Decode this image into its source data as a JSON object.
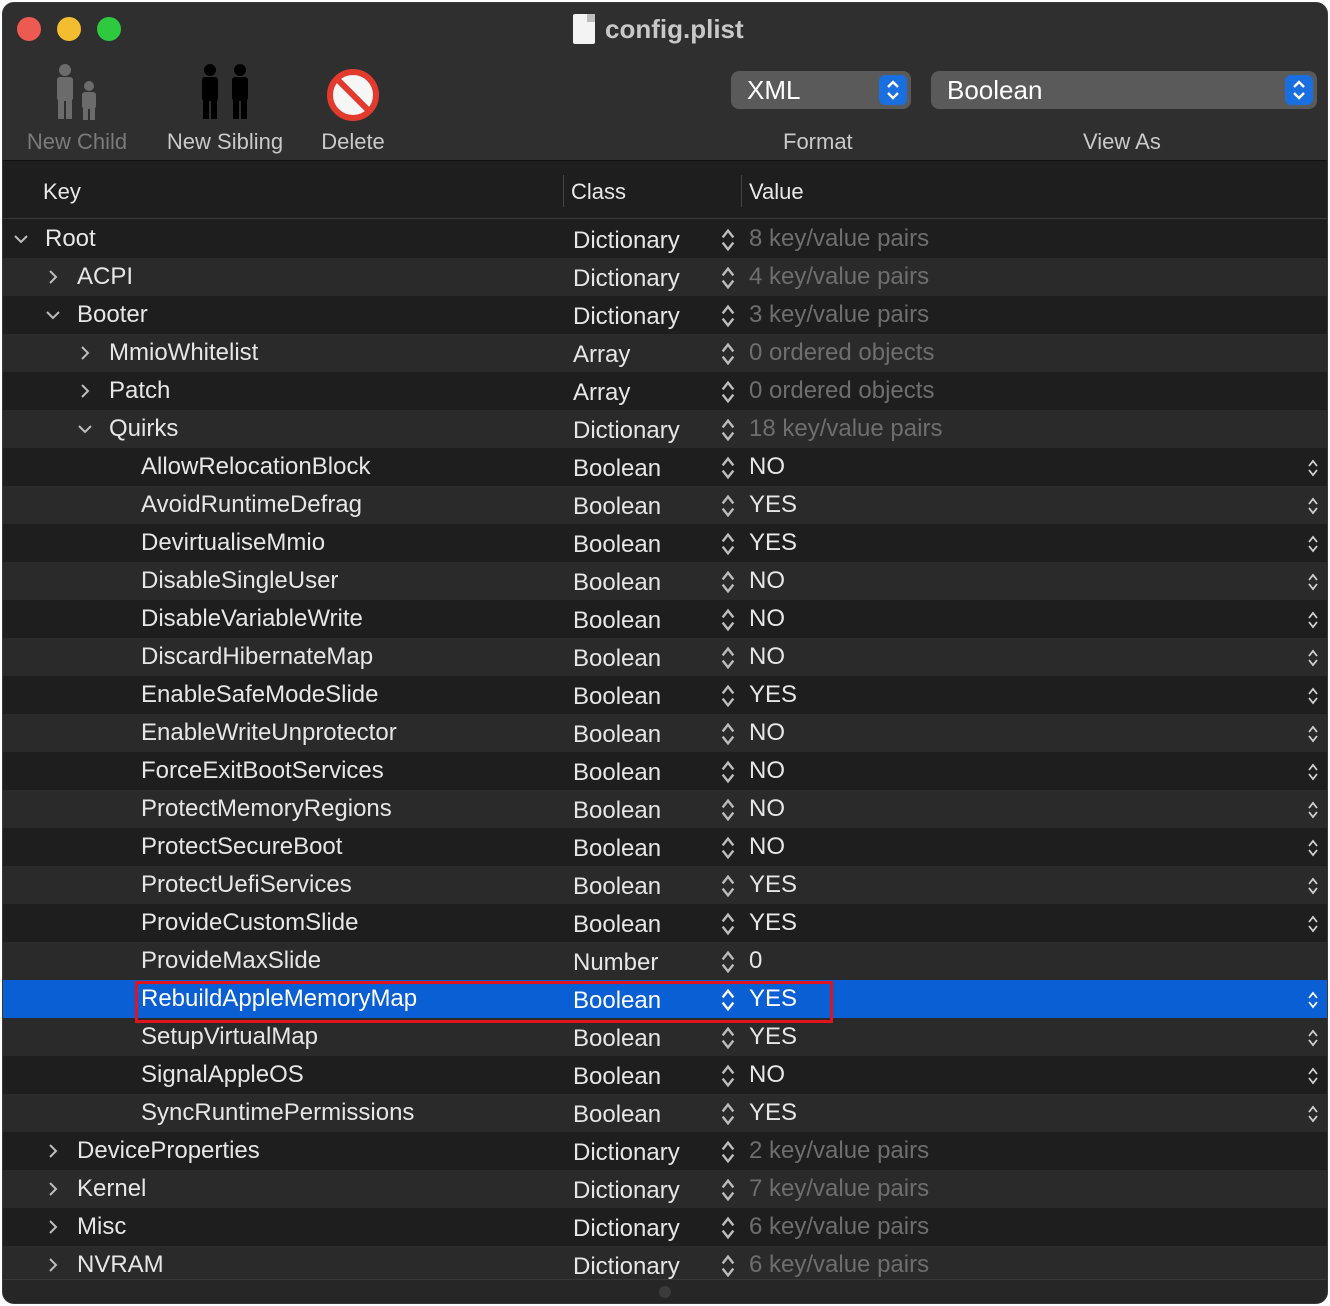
{
  "window": {
    "title": "config.plist"
  },
  "toolbar": {
    "new_child": "New Child",
    "new_sibling": "New Sibling",
    "delete": "Delete",
    "format_value": "XML",
    "view_as_value": "Boolean",
    "format_label": "Format",
    "view_as_label": "View As"
  },
  "columns": {
    "key": "Key",
    "class": "Class",
    "value": "Value"
  },
  "rows": [
    {
      "key": "Root",
      "depth": 0,
      "disclosure": "down",
      "class": "Dictionary",
      "value": "8 key/value pairs",
      "dim": true
    },
    {
      "key": "ACPI",
      "depth": 1,
      "disclosure": "right",
      "class": "Dictionary",
      "value": "4 key/value pairs",
      "dim": true
    },
    {
      "key": "Booter",
      "depth": 1,
      "disclosure": "down",
      "class": "Dictionary",
      "value": "3 key/value pairs",
      "dim": true
    },
    {
      "key": "MmioWhitelist",
      "depth": 2,
      "disclosure": "right",
      "class": "Array",
      "value": "0 ordered objects",
      "dim": true
    },
    {
      "key": "Patch",
      "depth": 2,
      "disclosure": "right",
      "class": "Array",
      "value": "0 ordered objects",
      "dim": true
    },
    {
      "key": "Quirks",
      "depth": 2,
      "disclosure": "down",
      "class": "Dictionary",
      "value": "18 key/value pairs",
      "dim": true
    },
    {
      "key": "AllowRelocationBlock",
      "depth": 3,
      "disclosure": "none",
      "class": "Boolean",
      "value": "NO",
      "bool": true
    },
    {
      "key": "AvoidRuntimeDefrag",
      "depth": 3,
      "disclosure": "none",
      "class": "Boolean",
      "value": "YES",
      "bool": true
    },
    {
      "key": "DevirtualiseMmio",
      "depth": 3,
      "disclosure": "none",
      "class": "Boolean",
      "value": "YES",
      "bool": true
    },
    {
      "key": "DisableSingleUser",
      "depth": 3,
      "disclosure": "none",
      "class": "Boolean",
      "value": "NO",
      "bool": true
    },
    {
      "key": "DisableVariableWrite",
      "depth": 3,
      "disclosure": "none",
      "class": "Boolean",
      "value": "NO",
      "bool": true
    },
    {
      "key": "DiscardHibernateMap",
      "depth": 3,
      "disclosure": "none",
      "class": "Boolean",
      "value": "NO",
      "bool": true
    },
    {
      "key": "EnableSafeModeSlide",
      "depth": 3,
      "disclosure": "none",
      "class": "Boolean",
      "value": "YES",
      "bool": true
    },
    {
      "key": "EnableWriteUnprotector",
      "depth": 3,
      "disclosure": "none",
      "class": "Boolean",
      "value": "NO",
      "bool": true
    },
    {
      "key": "ForceExitBootServices",
      "depth": 3,
      "disclosure": "none",
      "class": "Boolean",
      "value": "NO",
      "bool": true
    },
    {
      "key": "ProtectMemoryRegions",
      "depth": 3,
      "disclosure": "none",
      "class": "Boolean",
      "value": "NO",
      "bool": true
    },
    {
      "key": "ProtectSecureBoot",
      "depth": 3,
      "disclosure": "none",
      "class": "Boolean",
      "value": "NO",
      "bool": true
    },
    {
      "key": "ProtectUefiServices",
      "depth": 3,
      "disclosure": "none",
      "class": "Boolean",
      "value": "YES",
      "bool": true
    },
    {
      "key": "ProvideCustomSlide",
      "depth": 3,
      "disclosure": "none",
      "class": "Boolean",
      "value": "YES",
      "bool": true
    },
    {
      "key": "ProvideMaxSlide",
      "depth": 3,
      "disclosure": "none",
      "class": "Number",
      "value": "0"
    },
    {
      "key": "RebuildAppleMemoryMap",
      "depth": 3,
      "disclosure": "none",
      "class": "Boolean",
      "value": "YES",
      "bool": true,
      "selected": true
    },
    {
      "key": "SetupVirtualMap",
      "depth": 3,
      "disclosure": "none",
      "class": "Boolean",
      "value": "YES",
      "bool": true
    },
    {
      "key": "SignalAppleOS",
      "depth": 3,
      "disclosure": "none",
      "class": "Boolean",
      "value": "NO",
      "bool": true
    },
    {
      "key": "SyncRuntimePermissions",
      "depth": 3,
      "disclosure": "none",
      "class": "Boolean",
      "value": "YES",
      "bool": true
    },
    {
      "key": "DeviceProperties",
      "depth": 1,
      "disclosure": "right",
      "class": "Dictionary",
      "value": "2 key/value pairs",
      "dim": true
    },
    {
      "key": "Kernel",
      "depth": 1,
      "disclosure": "right",
      "class": "Dictionary",
      "value": "7 key/value pairs",
      "dim": true
    },
    {
      "key": "Misc",
      "depth": 1,
      "disclosure": "right",
      "class": "Dictionary",
      "value": "6 key/value pairs",
      "dim": true
    },
    {
      "key": "NVRAM",
      "depth": 1,
      "disclosure": "right",
      "class": "Dictionary",
      "value": "6 key/value pairs",
      "dim": true
    }
  ],
  "colors": {
    "selection": "#0a5fd4",
    "highlight_box": "#e0141e",
    "accent": "#1a6fe0"
  }
}
